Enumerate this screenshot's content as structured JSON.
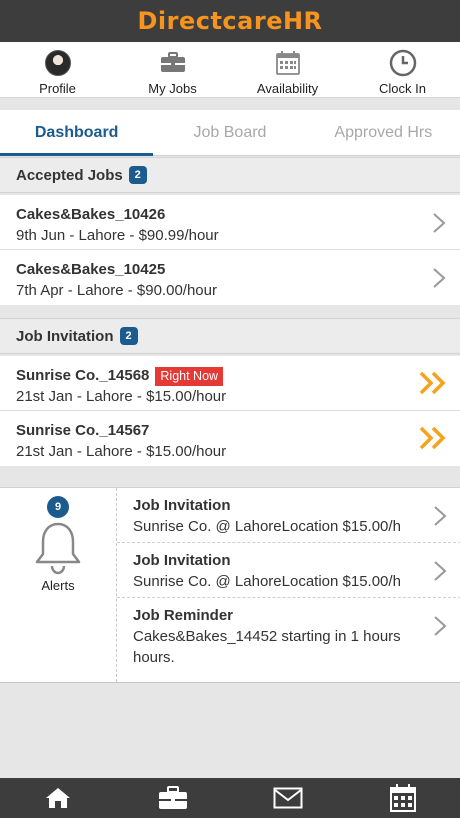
{
  "app": {
    "title": "DirectcareHR"
  },
  "topnav": [
    {
      "label": "Profile",
      "icon": "avatar"
    },
    {
      "label": "My Jobs",
      "icon": "briefcase-icon"
    },
    {
      "label": "Availability",
      "icon": "calendar-icon"
    },
    {
      "label": "Clock In",
      "icon": "clock-icon"
    }
  ],
  "tabs": [
    {
      "label": "Dashboard",
      "active": true
    },
    {
      "label": "Job Board",
      "active": false
    },
    {
      "label": "Approved Hrs",
      "active": false
    }
  ],
  "accepted_jobs": {
    "heading": "Accepted Jobs",
    "count": "2",
    "items": [
      {
        "title": "Cakes&Bakes_10426",
        "detail": "9th Jun - Lahore - $90.99/hour"
      },
      {
        "title": "Cakes&Bakes_10425",
        "detail": "7th Apr - Lahore - $90.00/hour"
      }
    ]
  },
  "job_invitation": {
    "heading": "Job Invitation",
    "count": "2",
    "items": [
      {
        "title": "Sunrise Co._14568",
        "badge": "Right Now",
        "detail": "21st Jan - Lahore - $15.00/hour"
      },
      {
        "title": "Sunrise Co._14567",
        "detail": "21st Jan - Lahore - $15.00/hour"
      }
    ]
  },
  "alerts": {
    "label": "Alerts",
    "count": "9",
    "items": [
      {
        "title": "Job Invitation",
        "body": "Sunrise Co. @ LahoreLocation $15.00/h"
      },
      {
        "title": "Job Invitation",
        "body": "Sunrise Co. @ LahoreLocation $15.00/h"
      },
      {
        "title": "Job Reminder",
        "body": "Cakes&Bakes_14452 starting in 1 hours hours."
      }
    ]
  },
  "bottom_nav": [
    {
      "icon": "home-icon"
    },
    {
      "icon": "briefcase-icon"
    },
    {
      "icon": "mail-icon"
    },
    {
      "icon": "calendar-icon"
    }
  ],
  "colors": {
    "header_bg": "#3d3d3d",
    "brand_orange": "#f7941d",
    "accent_blue": "#1c5b8e",
    "badge_red": "#e53935"
  }
}
